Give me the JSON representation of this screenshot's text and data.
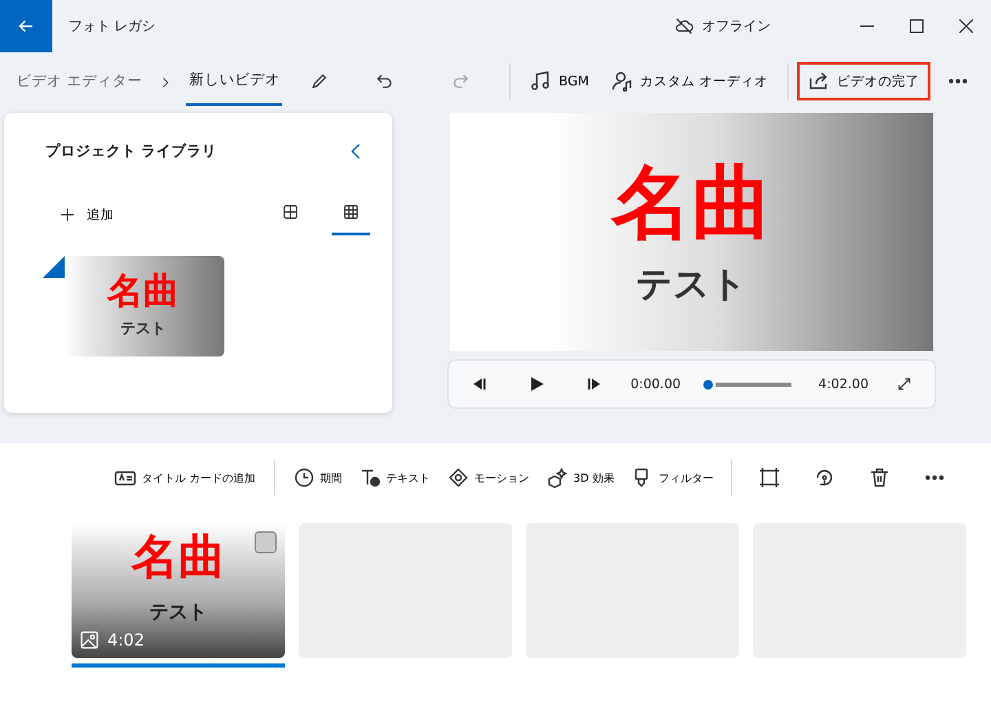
{
  "window": {
    "title": "フォト レガシ",
    "status": "オフライン"
  },
  "breadcrumb": [
    {
      "label": "ビデオ エディター",
      "selected": false
    },
    {
      "label": "新しいビデオ",
      "selected": true
    }
  ],
  "actions": [
    {
      "kind": "music",
      "label": "BGM",
      "highlighted": false
    },
    {
      "kind": "audio",
      "label": "カスタム オーディオ",
      "highlighted": false
    },
    {
      "kind": "export",
      "label": "ビデオの完了",
      "highlighted": true
    }
  ],
  "library": {
    "title": "プロジェクト ライブラリ",
    "add": "追加",
    "views": [
      {
        "kind": "large",
        "selected": false
      },
      {
        "kind": "small",
        "selected": true
      }
    ],
    "items": [
      {
        "title": "名曲",
        "subtitle": "テスト",
        "in_use": true
      }
    ]
  },
  "preview": {
    "title": "名曲",
    "subtitle": "テスト",
    "current_time": "0:00.00",
    "total_time": "4:02.00",
    "level": 0
  },
  "storyboard_tools": [
    {
      "kind": "title-card",
      "label": "タイトル カードの追加"
    },
    {
      "kind": "divider"
    },
    {
      "kind": "duration",
      "label": "期間"
    },
    {
      "kind": "text",
      "label": "テキスト"
    },
    {
      "kind": "motion",
      "label": "モーション"
    },
    {
      "kind": "effects",
      "label": "3D 効果"
    },
    {
      "kind": "filter",
      "label": "フィルター"
    },
    {
      "kind": "divider"
    },
    {
      "kind": "crop"
    },
    {
      "kind": "rotate"
    },
    {
      "kind": "delete"
    },
    {
      "kind": "more"
    }
  ],
  "clips": [
    {
      "kind": "title",
      "title": "名曲",
      "subtitle": "テスト",
      "duration": "4:02",
      "checked": false,
      "selected": true
    },
    {
      "kind": "empty",
      "selected": false
    },
    {
      "kind": "empty",
      "selected": false
    },
    {
      "kind": "empty",
      "selected": false
    }
  ]
}
